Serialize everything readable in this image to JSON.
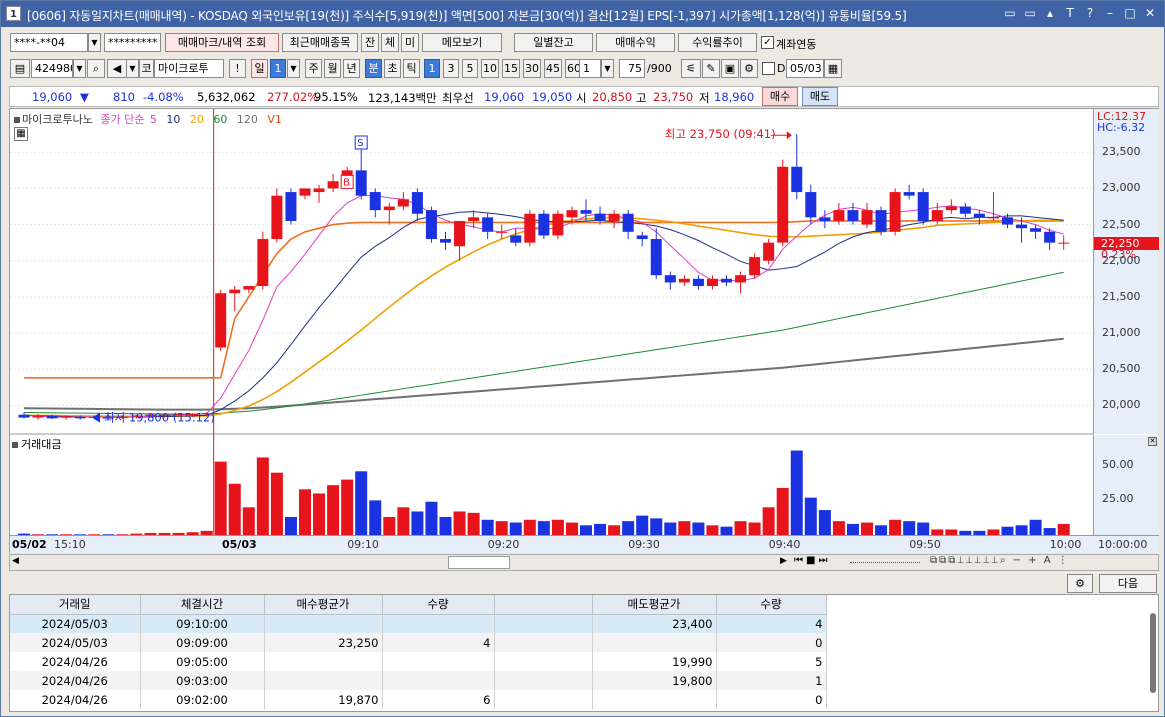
{
  "title": {
    "number": "1",
    "text": "[0606] 자동일지차트(매매내역) - KOSDAQ 외국인보유[19(천)] 주식수[5,919(천)] 액면[500] 자본금[30(억)] 결산[12월] EPS[-1,397] 시가총액[1,128(억)] 유통비율[59.5]",
    "btns": [
      "▭",
      "▭",
      "▴",
      "T",
      "?",
      "–",
      "□",
      "✕"
    ]
  },
  "toolbar1": {
    "account": "****-**04",
    "password": "*********",
    "btn_mark": "매매마크/내역 조회",
    "btn_recent": "최근매매종목",
    "btn_jan": "잔",
    "btn_che": "체",
    "btn_mi": "미",
    "btn_memo": "메모보기",
    "btn_daily": "일별잔고",
    "btn_profit": "매매수익",
    "btn_rate": "수익률추이",
    "chk_link_label": "계좌연동",
    "chk_link_mark": "✓"
  },
  "toolbar2": {
    "code": "424980",
    "ko": "코",
    "stock_name": "마이크로투",
    "excl": "!",
    "il": "일",
    "il_num": "1",
    "ju": "주",
    "wol": "월",
    "nyeon": "년",
    "bun": "분",
    "cho": "초",
    "tik": "틱",
    "periods": [
      "1",
      "3",
      "5",
      "10",
      "15",
      "30",
      "45",
      "60"
    ],
    "count": "1",
    "range": "75",
    "range_total": "/900",
    "d_label": "D",
    "date": "05/03"
  },
  "quote": {
    "price": "19,060",
    "arrow": "▼",
    "change": "810",
    "pct": "-4.08%",
    "volume": "5,632,062",
    "vol_ratio": "277.02%",
    "ratio2": "95.15%",
    "amount": "123,143백만",
    "best_label": "최우선",
    "best1": "19,060",
    "best2": "19,050",
    "open_label": "시",
    "open": "20,850",
    "high_label": "고",
    "high": "23,750",
    "low_label": "저",
    "low": "18,960",
    "buy": "매수",
    "sell": "매도"
  },
  "legend": {
    "name": "마이크로투나노",
    "ma_label": "종가 단순",
    "ma5": "5",
    "ma10": "10",
    "ma20": "20",
    "ma60": "60",
    "ma120": "120",
    "v1": "V1"
  },
  "price_axis": {
    "lc": "LC:12.37",
    "hc": "HC:-6.32",
    "current": "22,250",
    "current_pct": "0.23%"
  },
  "volume_panel": {
    "title": "거래대금"
  },
  "annotations": {
    "high": "최고 23,750 (09:41)",
    "low": "최저 19,800 (15:12)",
    "s_mark": "S",
    "b_mark": "B"
  },
  "colors": {
    "up": "#e8141c",
    "down": "#1a32e0",
    "ma5": "#e040c0",
    "ma10": "#1c2e80",
    "ma20": "#f0a000",
    "ma60": "#1a8a3a",
    "ma120": "#707070",
    "v1": "#f07020"
  },
  "chart_data": {
    "type": "candlestick",
    "price_ticks": [
      "23,500",
      "23,000",
      "22,500",
      "22,000",
      "21,500",
      "21,000",
      "20,500",
      "20,000"
    ],
    "volume_ticks": [
      "50.00",
      "25.00"
    ],
    "time_ticks": [
      "05/02",
      "15:10",
      "05/03",
      "09:10",
      "09:20",
      "09:30",
      "09:40",
      "09:50",
      "10:00",
      "10:00:00"
    ],
    "ylim": [
      19700,
      23850
    ],
    "candles": [
      {
        "o": 19870,
        "h": 19900,
        "l": 19820,
        "c": 19830,
        "v": 1.0
      },
      {
        "o": 19830,
        "h": 19880,
        "l": 19800,
        "c": 19850,
        "v": 0.5
      },
      {
        "o": 19850,
        "h": 19870,
        "l": 19810,
        "c": 19820,
        "v": 0.5
      },
      {
        "o": 19830,
        "h": 19860,
        "l": 19800,
        "c": 19850,
        "v": 0.5
      },
      {
        "o": 19840,
        "h": 19860,
        "l": 19800,
        "c": 19820,
        "v": 0.5
      },
      {
        "o": 19830,
        "h": 19860,
        "l": 19810,
        "c": 19840,
        "v": 0.5
      },
      {
        "o": 19830,
        "h": 19850,
        "l": 19810,
        "c": 19820,
        "v": 0.5
      },
      {
        "o": 19830,
        "h": 19860,
        "l": 19810,
        "c": 19840,
        "v": 0.5
      },
      {
        "o": 19850,
        "h": 19870,
        "l": 19820,
        "c": 19860,
        "v": 1.0
      },
      {
        "o": 19860,
        "h": 19880,
        "l": 19830,
        "c": 19870,
        "v": 1.5
      },
      {
        "o": 19860,
        "h": 19880,
        "l": 19830,
        "c": 19870,
        "v": 1.5
      },
      {
        "o": 19870,
        "h": 19890,
        "l": 19840,
        "c": 19880,
        "v": 1.5
      },
      {
        "o": 19870,
        "h": 19890,
        "l": 19840,
        "c": 19880,
        "v": 2.0
      },
      {
        "o": 19880,
        "h": 19900,
        "l": 19850,
        "c": 19890,
        "v": 3.0
      },
      {
        "o": 20800,
        "h": 21600,
        "l": 20750,
        "c": 21550,
        "v": 53
      },
      {
        "o": 21550,
        "h": 21650,
        "l": 21300,
        "c": 21600,
        "v": 37
      },
      {
        "o": 21600,
        "h": 21650,
        "l": 21550,
        "c": 21650,
        "v": 20
      },
      {
        "o": 21650,
        "h": 22400,
        "l": 21600,
        "c": 22300,
        "v": 56
      },
      {
        "o": 22300,
        "h": 23000,
        "l": 22250,
        "c": 22900,
        "v": 45
      },
      {
        "o": 22950,
        "h": 23000,
        "l": 22500,
        "c": 22550,
        "v": 13
      },
      {
        "o": 22900,
        "h": 23000,
        "l": 22850,
        "c": 23000,
        "v": 33
      },
      {
        "o": 22950,
        "h": 23050,
        "l": 22800,
        "c": 23000,
        "v": 30
      },
      {
        "o": 23000,
        "h": 23200,
        "l": 22950,
        "c": 23100,
        "v": 36
      },
      {
        "o": 23100,
        "h": 23300,
        "l": 23050,
        "c": 23250,
        "v": 40
      },
      {
        "o": 23250,
        "h": 23400,
        "l": 22850,
        "c": 22900,
        "v": 46
      },
      {
        "o": 22950,
        "h": 23000,
        "l": 22600,
        "c": 22700,
        "v": 25
      },
      {
        "o": 22700,
        "h": 22800,
        "l": 22500,
        "c": 22750,
        "v": 13
      },
      {
        "o": 22750,
        "h": 22950,
        "l": 22700,
        "c": 22850,
        "v": 20
      },
      {
        "o": 22950,
        "h": 23000,
        "l": 22550,
        "c": 22650,
        "v": 17
      },
      {
        "o": 22700,
        "h": 22750,
        "l": 22250,
        "c": 22300,
        "v": 24
      },
      {
        "o": 22300,
        "h": 22400,
        "l": 22150,
        "c": 22250,
        "v": 13
      },
      {
        "o": 22200,
        "h": 22550,
        "l": 22000,
        "c": 22550,
        "v": 17
      },
      {
        "o": 22550,
        "h": 22700,
        "l": 22450,
        "c": 22600,
        "v": 16
      },
      {
        "o": 22600,
        "h": 22650,
        "l": 22300,
        "c": 22400,
        "v": 11
      },
      {
        "o": 22400,
        "h": 22500,
        "l": 22300,
        "c": 22400,
        "v": 10
      },
      {
        "o": 22350,
        "h": 22450,
        "l": 22200,
        "c": 22250,
        "v": 9
      },
      {
        "o": 22250,
        "h": 22700,
        "l": 22200,
        "c": 22650,
        "v": 11
      },
      {
        "o": 22650,
        "h": 22700,
        "l": 22300,
        "c": 22350,
        "v": 10
      },
      {
        "o": 22350,
        "h": 22700,
        "l": 22300,
        "c": 22650,
        "v": 11
      },
      {
        "o": 22600,
        "h": 22750,
        "l": 22500,
        "c": 22700,
        "v": 9
      },
      {
        "o": 22700,
        "h": 22850,
        "l": 22550,
        "c": 22650,
        "v": 7
      },
      {
        "o": 22650,
        "h": 22750,
        "l": 22500,
        "c": 22550,
        "v": 8
      },
      {
        "o": 22550,
        "h": 22700,
        "l": 22450,
        "c": 22650,
        "v": 7
      },
      {
        "o": 22650,
        "h": 22700,
        "l": 22300,
        "c": 22400,
        "v": 10
      },
      {
        "o": 22350,
        "h": 22400,
        "l": 22200,
        "c": 22300,
        "v": 14
      },
      {
        "o": 22300,
        "h": 22450,
        "l": 21750,
        "c": 21800,
        "v": 12
      },
      {
        "o": 21800,
        "h": 21850,
        "l": 21600,
        "c": 21700,
        "v": 9
      },
      {
        "o": 21700,
        "h": 21800,
        "l": 21650,
        "c": 21750,
        "v": 10
      },
      {
        "o": 21750,
        "h": 21800,
        "l": 21600,
        "c": 21650,
        "v": 9
      },
      {
        "o": 21650,
        "h": 21800,
        "l": 21600,
        "c": 21750,
        "v": 7
      },
      {
        "o": 21750,
        "h": 21800,
        "l": 21650,
        "c": 21700,
        "v": 6
      },
      {
        "o": 21700,
        "h": 21850,
        "l": 21550,
        "c": 21800,
        "v": 10
      },
      {
        "o": 21800,
        "h": 22100,
        "l": 21750,
        "c": 22050,
        "v": 9
      },
      {
        "o": 22000,
        "h": 22300,
        "l": 21950,
        "c": 22250,
        "v": 20
      },
      {
        "o": 22250,
        "h": 23400,
        "l": 22200,
        "c": 23300,
        "v": 34
      },
      {
        "o": 23300,
        "h": 23750,
        "l": 22850,
        "c": 22950,
        "v": 61
      },
      {
        "o": 22950,
        "h": 23050,
        "l": 22500,
        "c": 22600,
        "v": 27
      },
      {
        "o": 22600,
        "h": 22700,
        "l": 22450,
        "c": 22550,
        "v": 18
      },
      {
        "o": 22550,
        "h": 22800,
        "l": 22500,
        "c": 22700,
        "v": 10
      },
      {
        "o": 22700,
        "h": 22800,
        "l": 22500,
        "c": 22550,
        "v": 8
      },
      {
        "o": 22500,
        "h": 22800,
        "l": 22450,
        "c": 22700,
        "v": 9
      },
      {
        "o": 22700,
        "h": 22750,
        "l": 22350,
        "c": 22400,
        "v": 7
      },
      {
        "o": 22400,
        "h": 23000,
        "l": 22350,
        "c": 22950,
        "v": 11
      },
      {
        "o": 22950,
        "h": 23050,
        "l": 22850,
        "c": 22900,
        "v": 10
      },
      {
        "o": 22950,
        "h": 23000,
        "l": 22500,
        "c": 22550,
        "v": 9
      },
      {
        "o": 22550,
        "h": 22800,
        "l": 22500,
        "c": 22700,
        "v": 4
      },
      {
        "o": 22700,
        "h": 22850,
        "l": 22650,
        "c": 22750,
        "v": 4
      },
      {
        "o": 22750,
        "h": 22800,
        "l": 22600,
        "c": 22650,
        "v": 3
      },
      {
        "o": 22650,
        "h": 22700,
        "l": 22500,
        "c": 22600,
        "v": 3
      },
      {
        "o": 22600,
        "h": 22950,
        "l": 22550,
        "c": 22600,
        "v": 4
      },
      {
        "o": 22600,
        "h": 22650,
        "l": 22450,
        "c": 22500,
        "v": 6
      },
      {
        "o": 22500,
        "h": 22600,
        "l": 22250,
        "c": 22450,
        "v": 7
      },
      {
        "o": 22450,
        "h": 22500,
        "l": 22300,
        "c": 22400,
        "v": 11
      },
      {
        "o": 22400,
        "h": 22450,
        "l": 22150,
        "c": 22250,
        "v": 5
      },
      {
        "o": 22250,
        "h": 22350,
        "l": 22150,
        "c": 22250,
        "v": 8
      }
    ],
    "ma5": [
      19860,
      19850,
      19840,
      19835,
      19838,
      19840,
      19835,
      19835,
      19840,
      19850,
      19860,
      19870,
      19878,
      19885,
      20100,
      20430,
      20760,
      21180,
      21640,
      21850,
      22090,
      22350,
      22610,
      22800,
      22900,
      22900,
      22870,
      22850,
      22780,
      22650,
      22560,
      22500,
      22470,
      22420,
      22400,
      22450,
      22450,
      22430,
      22460,
      22530,
      22620,
      22650,
      22630,
      22580,
      22530,
      22400,
      22210,
      22030,
      21840,
      21730,
      21730,
      21720,
      21760,
      21880,
      22160,
      22340,
      22510,
      22630,
      22710,
      22740,
      22700,
      22640,
      22670,
      22690,
      22710,
      22740,
      22760,
      22730,
      22700,
      22650,
      22590,
      22550,
      22500,
      22420,
      22370
    ],
    "ma10": [
      19860,
      19855,
      19850,
      19845,
      19840,
      19838,
      19837,
      19836,
      19838,
      19840,
      19845,
      19850,
      19855,
      19860,
      19940,
      20060,
      20200,
      20380,
      20590,
      20840,
      21100,
      21350,
      21580,
      21820,
      22050,
      22200,
      22320,
      22460,
      22570,
      22610,
      22640,
      22670,
      22680,
      22660,
      22640,
      22610,
      22570,
      22550,
      22540,
      22540,
      22550,
      22560,
      22540,
      22530,
      22510,
      22480,
      22430,
      22360,
      22280,
      22180,
      22090,
      21990,
      21930,
      21870,
      21890,
      21920,
      22020,
      22120,
      22240,
      22330,
      22390,
      22420,
      22460,
      22500,
      22530,
      22580,
      22600,
      22580,
      22600,
      22600,
      22620,
      22620,
      22600,
      22580,
      22560
    ],
    "ma20": [
      19860,
      19860,
      19858,
      19856,
      19854,
      19852,
      19850,
      19849,
      19848,
      19848,
      19849,
      19850,
      19851,
      19852,
      19880,
      19930,
      19990,
      20080,
      20190,
      20320,
      20460,
      20600,
      20740,
      20890,
      21040,
      21200,
      21360,
      21510,
      21660,
      21790,
      21910,
      22020,
      22120,
      22220,
      22300,
      22370,
      22430,
      22480,
      22530,
      22560,
      22580,
      22590,
      22600,
      22590,
      22580,
      22560,
      22540,
      22510,
      22480,
      22450,
      22420,
      22390,
      22360,
      22340,
      22330,
      22330,
      22340,
      22350,
      22360,
      22370,
      22380,
      22400,
      22420,
      22440,
      22460,
      22490,
      22500,
      22510,
      22520,
      22530,
      22540,
      22550,
      22560,
      22560,
      22560
    ],
    "ma60": [
      19900,
      19898,
      19896,
      19894,
      19892,
      19890,
      19888,
      19886,
      19884,
      19882,
      19880,
      19880,
      19880,
      19880,
      19890,
      19905,
      19920,
      19940,
      19965,
      19990,
      20020,
      20050,
      20080,
      20110,
      20140,
      20170,
      20200,
      20230,
      20260,
      20290,
      20320,
      20350,
      20380,
      20410,
      20440,
      20470,
      20500,
      20530,
      20560,
      20590,
      20620,
      20650,
      20680,
      20710,
      20740,
      20770,
      20800,
      20830,
      20860,
      20890,
      20920,
      20950,
      20980,
      21010,
      21040,
      21080,
      21120,
      21160,
      21200,
      21240,
      21280,
      21320,
      21360,
      21400,
      21440,
      21480,
      21520,
      21560,
      21600,
      21640,
      21680,
      21720,
      21760,
      21800,
      21840
    ],
    "ma120": [
      19960,
      19958,
      19956,
      19954,
      19952,
      19950,
      19948,
      19946,
      19944,
      19942,
      19940,
      19940,
      19940,
      19940,
      19945,
      19952,
      19960,
      19970,
      19982,
      19995,
      20010,
      20025,
      20040,
      20055,
      20070,
      20085,
      20100,
      20115,
      20130,
      20145,
      20160,
      20175,
      20190,
      20205,
      20220,
      20235,
      20250,
      20265,
      20280,
      20295,
      20310,
      20325,
      20340,
      20355,
      20370,
      20385,
      20400,
      20415,
      20430,
      20445,
      20460,
      20475,
      20490,
      20505,
      20520,
      20540,
      20560,
      20580,
      20600,
      20620,
      20640,
      20660,
      20680,
      20700,
      20720,
      20740,
      20760,
      20780,
      20800,
      20820,
      20840,
      20860,
      20880,
      20900,
      20920
    ],
    "v1": [
      20380,
      20380,
      20380,
      20380,
      20380,
      20380,
      20380,
      20380,
      20380,
      20380,
      20380,
      20380,
      20380,
      20380,
      20380,
      21200,
      21500,
      21800,
      22100,
      22300,
      22400,
      22450,
      22500,
      22520,
      22530,
      22530,
      22530,
      22530,
      22530,
      22530,
      22530,
      22530,
      22530,
      22530,
      22530,
      22530,
      22530,
      22530,
      22530,
      22530,
      22530,
      22530,
      22530,
      22530,
      22530,
      22530,
      22530,
      22530,
      22530,
      22530,
      22530,
      22530,
      22530,
      22530,
      22530,
      22540,
      22550,
      22550,
      22550,
      22550,
      22550,
      22550,
      22550,
      22550,
      22550,
      22550,
      22550,
      22550,
      22550,
      22550,
      22550,
      22550,
      22550,
      22550,
      22550
    ]
  },
  "bottom_toolbar": {
    "next": "다음",
    "gear": "⚙"
  },
  "table": {
    "headers": [
      "거래일",
      "체결시간",
      "매수평균가",
      "수량",
      "",
      "매도평균가",
      "수량"
    ],
    "rows": [
      [
        "2024/05/03",
        "09:10:00",
        "",
        "",
        "",
        "23,400",
        "4"
      ],
      [
        "2024/05/03",
        "09:09:00",
        "23,250",
        "4",
        "",
        "",
        "0"
      ],
      [
        "2024/04/26",
        "09:05:00",
        "",
        "",
        "",
        "19,990",
        "5"
      ],
      [
        "2024/04/26",
        "09:03:00",
        "",
        "",
        "",
        "19,800",
        "1"
      ],
      [
        "2024/04/26",
        "09:02:00",
        "19,870",
        "6",
        "",
        "",
        "0"
      ]
    ]
  }
}
